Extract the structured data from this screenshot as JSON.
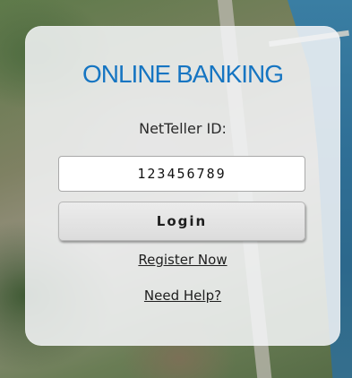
{
  "login_card": {
    "title": "ONLINE BANKING",
    "id_label": "NetTeller ID:",
    "id_value": "123456789",
    "login_label": "Login",
    "register_label": "Register Now",
    "help_label": "Need Help?"
  },
  "colors": {
    "title": "#1675c2",
    "card_background": "#f4f6f8",
    "button_background": "#e4e4e4"
  }
}
